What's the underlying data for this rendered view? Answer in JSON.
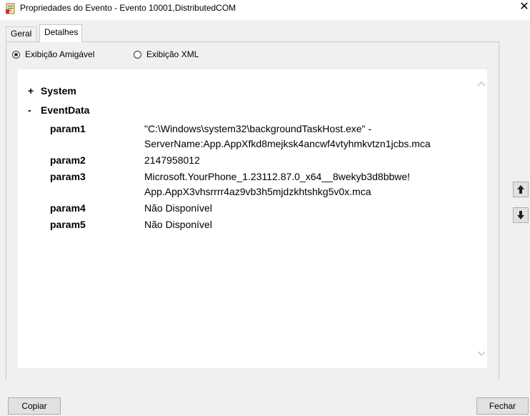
{
  "window": {
    "title": "Propriedades do Evento - Evento 10001,DistributedCOM",
    "app_icon": "event-viewer-icon",
    "close_glyph": "✕"
  },
  "tabs": [
    {
      "label": "Geral",
      "selected": false
    },
    {
      "label": "Detalhes",
      "selected": true
    }
  ],
  "view_mode": {
    "friendly_label": "Exibição Amigável",
    "xml_label": "Exibição XML",
    "selected": "friendly"
  },
  "tree": {
    "system": {
      "toggle": "+",
      "label": "System"
    },
    "eventdata": {
      "toggle": "-",
      "label": "EventData",
      "params": [
        {
          "name": "param1",
          "lines": [
            "\"C:\\Windows\\system32\\backgroundTaskHost.exe\" -",
            "ServerName:App.AppXfkd8mejksk4ancwf4vtyhmkvtzn1jcbs.mca"
          ]
        },
        {
          "name": "param2",
          "lines": [
            "2147958012"
          ]
        },
        {
          "name": "param3",
          "lines": [
            "Microsoft.YourPhone_1.23112.87.0_x64__8wekyb3d8bbwe!",
            "App.AppX3vhsrrrr4az9vb3h5mjdzkhtshkg5v0x.mca"
          ]
        },
        {
          "name": "param4",
          "lines": [
            "Não Disponível"
          ]
        },
        {
          "name": "param5",
          "lines": [
            "Não Disponível"
          ]
        }
      ]
    }
  },
  "nav": {
    "up_icon": "arrow-up-icon",
    "down_icon": "arrow-down-icon"
  },
  "buttons": {
    "copy": "Copiar",
    "close": "Fechar"
  }
}
